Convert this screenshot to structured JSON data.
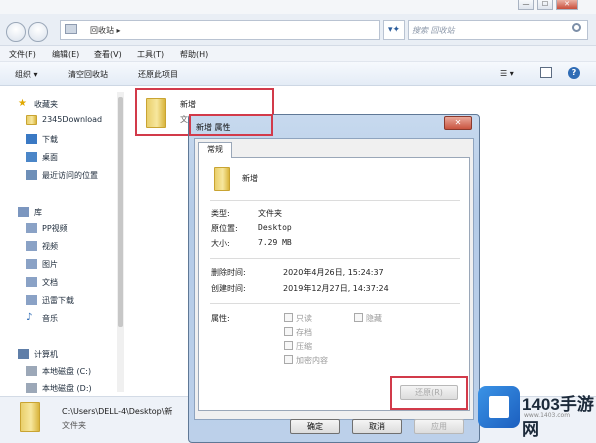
{
  "window": {
    "min": "—",
    "max": "☐",
    "close": "✕"
  },
  "address": {
    "path": "回收站 ▸",
    "refresh": "▾✦",
    "search_placeholder": "搜索 回收站"
  },
  "menu": [
    "文件(F)",
    "编辑(E)",
    "查看(V)",
    "工具(T)",
    "帮助(H)"
  ],
  "toolbar": {
    "organize": "组织 ▾",
    "empty": "清空回收站",
    "restore_all": "还原此项目",
    "view": "☰ ▾",
    "help": "?"
  },
  "nav": {
    "favorites": "收藏夹",
    "fav_items": [
      "2345Download",
      "下载",
      "桌面",
      "最近访问的位置"
    ],
    "libraries": "库",
    "lib_items": [
      "PP视频",
      "视频",
      "图片",
      "文档",
      "迅雷下载",
      "音乐"
    ],
    "computer": "计算机",
    "drives": [
      "本地磁盘 (C:)",
      "本地磁盘 (D:)"
    ]
  },
  "content": {
    "folder_name": "新增",
    "folder_sub": "文"
  },
  "status": {
    "path": "C:\\Users\\DELL-4\\Desktop\\新",
    "type": "文件夹"
  },
  "dialog": {
    "title": "新增 属性",
    "close": "✕",
    "tab": "常规",
    "name": "新增",
    "labels": {
      "type": "类型:",
      "origin": "原位置:",
      "size": "大小:",
      "deleted": "删除时间:",
      "created": "创建时间:",
      "attributes": "属性:"
    },
    "values": {
      "type": "文件夹",
      "origin": "Desktop",
      "size": "7.29 MB",
      "deleted": "2020年4月26日, 15:24:37",
      "created": "2019年12月27日, 14:37:24"
    },
    "checks": [
      "只读",
      "存档",
      "压缩",
      "加密内容"
    ],
    "check_hidden": "隐藏",
    "restore": "还原(R)",
    "ok": "确定",
    "cancel": "取消",
    "apply": "应用"
  },
  "watermark": {
    "brand": "1403手游网",
    "url": "www.1403.com"
  },
  "colors": {
    "highlight": "#d23a4a",
    "accent": "#2b5d9c"
  }
}
